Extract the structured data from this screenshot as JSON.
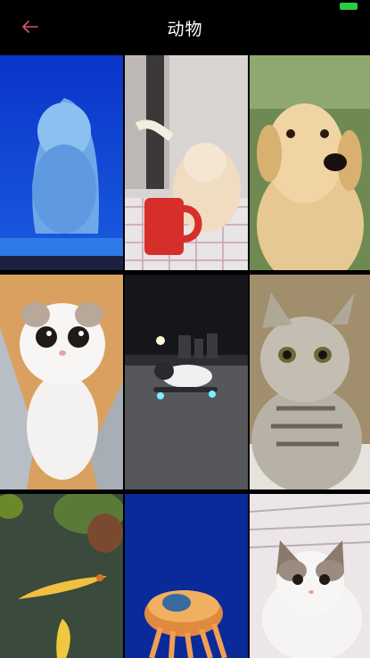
{
  "status_bar": {
    "battery_color": "#2ecc40"
  },
  "nav": {
    "title": "动物",
    "back_icon": "back-arrow-icon",
    "accent_color": "#d9556a"
  },
  "videos": [
    {
      "subject": "beluga-whale"
    },
    {
      "subject": "cat-with-red-mug"
    },
    {
      "subject": "golden-retriever-puppy"
    },
    {
      "subject": "white-kitten"
    },
    {
      "subject": "dog-on-skateboard"
    },
    {
      "subject": "tabby-cat"
    },
    {
      "subject": "koi-fish"
    },
    {
      "subject": "jellyfish"
    },
    {
      "subject": "ragdoll-kitten"
    }
  ]
}
